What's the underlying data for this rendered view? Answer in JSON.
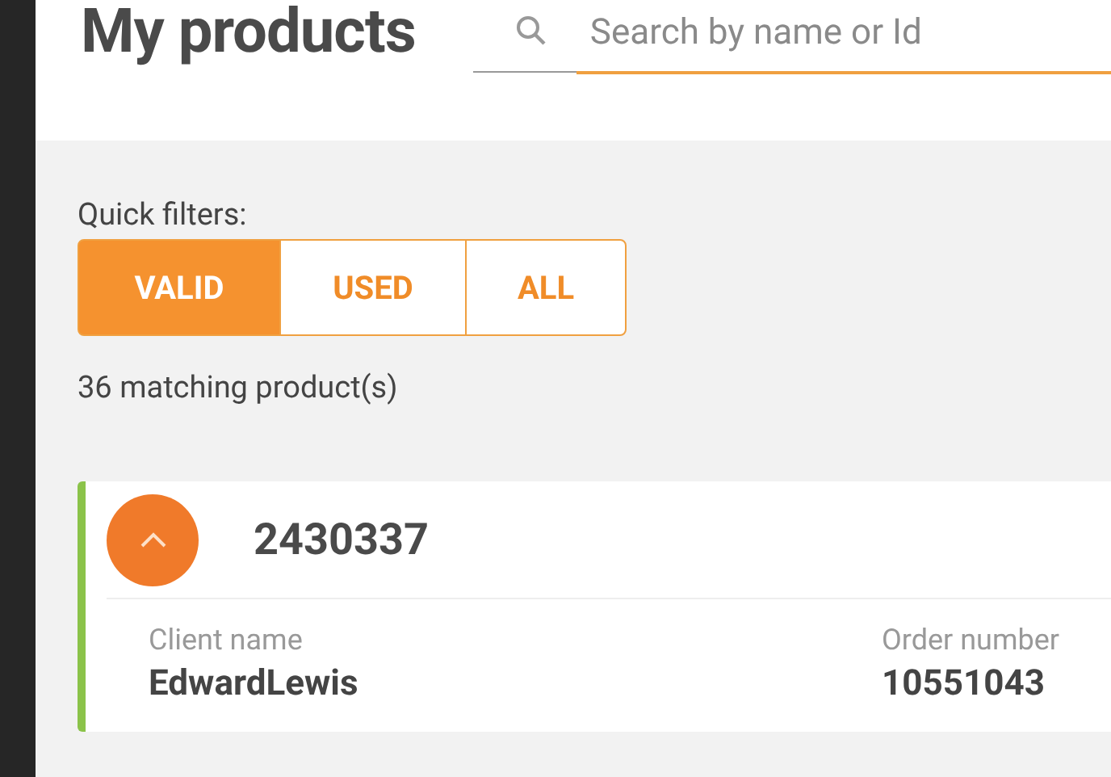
{
  "header": {
    "title": "My products",
    "search": {
      "placeholder": "Search by name or Id"
    }
  },
  "quick_filters": {
    "label": "Quick filters:",
    "options": [
      {
        "label": "VALID",
        "selected": true
      },
      {
        "label": "USED",
        "selected": false
      },
      {
        "label": "ALL",
        "selected": false
      }
    ]
  },
  "match_count": "36 matching product(s)",
  "products": [
    {
      "id": "2430337",
      "expanded": true,
      "color": "#8bc34a",
      "fields": [
        {
          "label": "Client name",
          "value": "EdwardLewis"
        },
        {
          "label": "Order number",
          "value": "10551043"
        }
      ]
    }
  ]
}
